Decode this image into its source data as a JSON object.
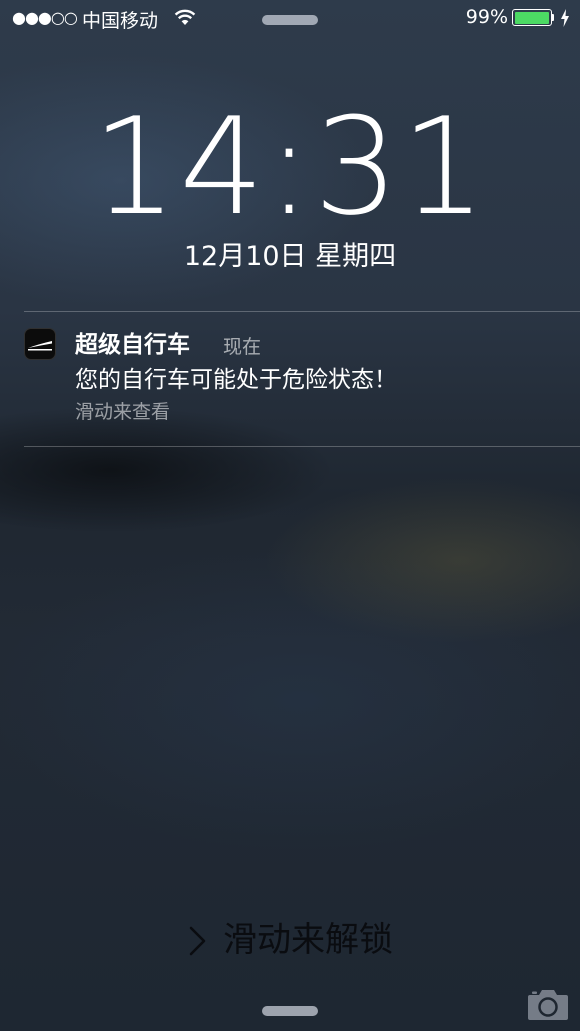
{
  "status_bar": {
    "signal": "●●●○○",
    "carrier": "中国移动",
    "wifi_icon": "wifi-icon",
    "battery_percent": "99%",
    "battery_level": 0.99,
    "battery_color": "#4cd964",
    "charging_icon": "bolt-icon"
  },
  "lockscreen": {
    "time": "14:31",
    "date": "12月10日 星期四"
  },
  "notification": {
    "app_icon": "bike-app-icon",
    "app_name": "超级自行车",
    "time": "现在",
    "message": "您的自行车可能处于危险状态！",
    "action": "滑动来查看"
  },
  "unlock": {
    "chevron_icon": "chevron-right-icon",
    "label": "滑动来解锁"
  },
  "camera_icon": "camera-icon"
}
